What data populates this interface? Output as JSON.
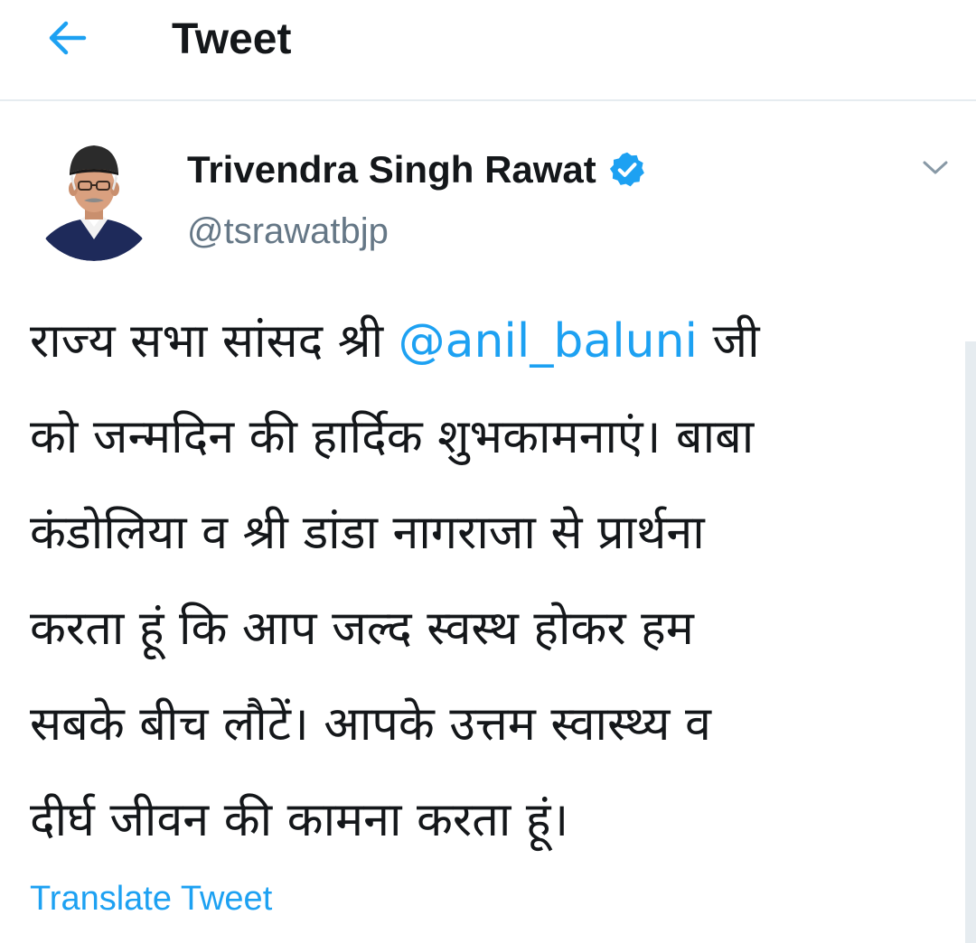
{
  "header": {
    "title": "Tweet",
    "back_icon": "arrow-left-icon"
  },
  "author": {
    "display_name": "Trivendra Singh Rawat",
    "handle": "@tsrawatbjp",
    "verified": true,
    "verified_icon": "verified-badge-icon"
  },
  "tweet": {
    "lines": [
      {
        "pre": "राज्य सभा सांसद श्री ",
        "mention": "@anil_baluni",
        "post": " जी"
      },
      {
        "text": "को जन्मदिन की हार्दिक शुभकामनाएं। बाबा"
      },
      {
        "text": "कंडोलिया व श्री डांडा नागराजा से प्रार्थना"
      },
      {
        "text": "करता हूं कि आप जल्द स्वस्थ होकर हम"
      },
      {
        "text": "सबके बीच लौटें। आपके उत्तम स्वास्थ्य व"
      },
      {
        "text": "दीर्घ जीवन की कामना करता हूं।"
      }
    ]
  },
  "translate_label": "Translate Tweet",
  "colors": {
    "accent": "#1da1f2",
    "text": "#14171a",
    "secondary": "#657786",
    "divider": "#e6ecf0"
  }
}
